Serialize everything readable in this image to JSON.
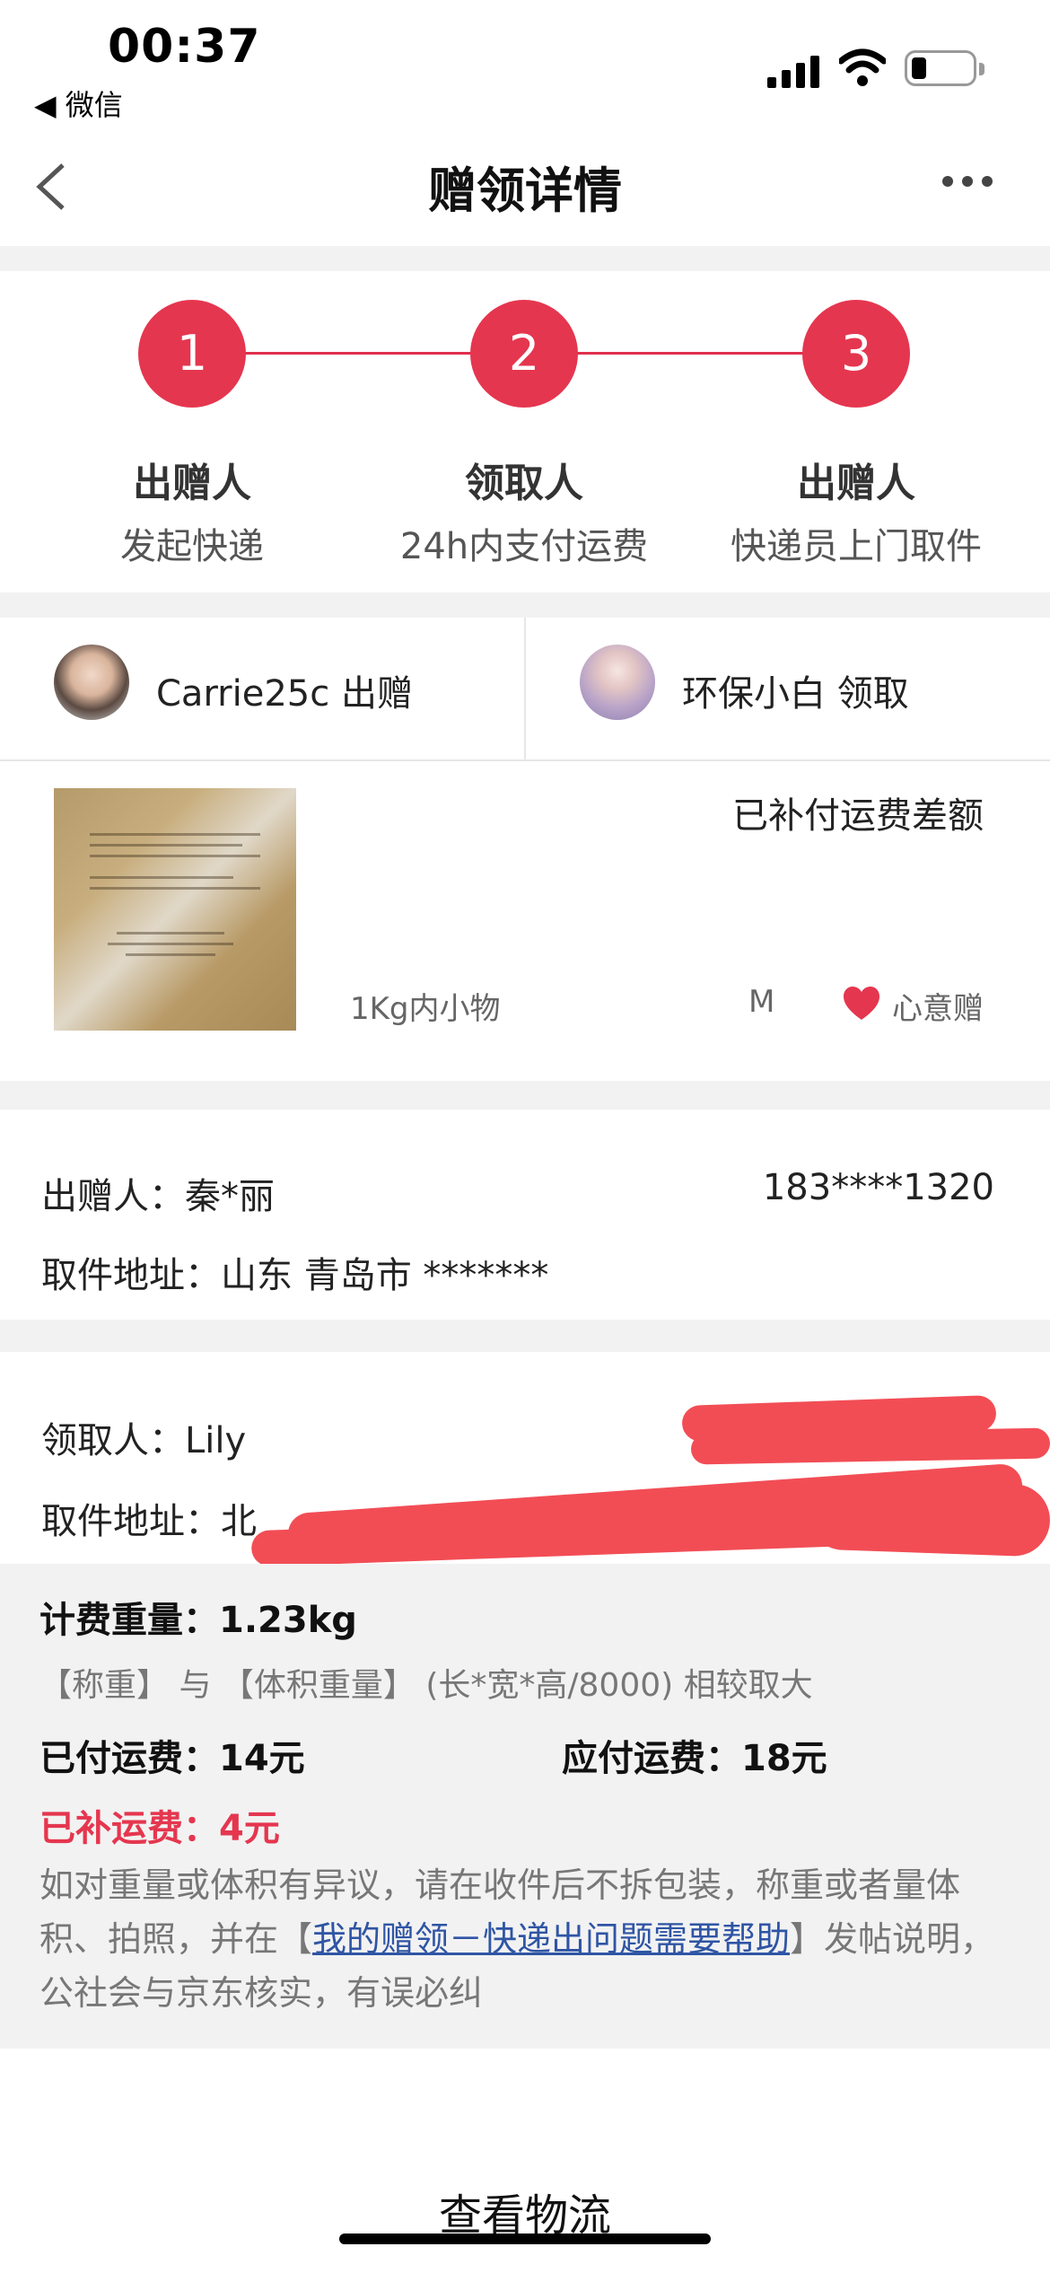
{
  "status_bar": {
    "time": "00:37",
    "back_app": "◀ 微信"
  },
  "nav": {
    "title": "赠领详情",
    "back_icon": "chevron-left-icon",
    "more_icon": "more-dots-icon"
  },
  "steps": [
    {
      "number": "1",
      "title": "出赠人",
      "subtitle": "发起快递"
    },
    {
      "number": "2",
      "title": "领取人",
      "subtitle": "24h内支付运费"
    },
    {
      "number": "3",
      "title": "出赠人",
      "subtitle": "快递员上门取件"
    }
  ],
  "users": {
    "giver": "Carrie25c 出赠",
    "receiver": "环保小白 领取"
  },
  "item": {
    "status": "已补付运费差额",
    "category": "1Kg内小物",
    "size": "M",
    "tag": "心意赠"
  },
  "giver_info": {
    "name": "出赠人：秦*丽",
    "phone": "183****1320",
    "address": "取件地址：山东 青岛市 *******"
  },
  "receiver_info": {
    "name": "领取人：Lily",
    "address": "取件地址：北"
  },
  "shipping": {
    "weight": "计费重量：1.23kg",
    "rule": "【称重】 与 【体积重量】 (长*宽*高/8000) 相较取大",
    "paid": "已付运费：14元",
    "due": "应付运费：18元",
    "supplement": "已补运费：4元",
    "note_before": "如对重量或体积有异议，请在收件后不拆包装，称重或者量体积、拍照，并在【",
    "note_link": "我的赠领－快递出问题需要帮助",
    "note_after": "】发帖说明，公社会与京东核实，有误必纠"
  },
  "bottom": {
    "button": "查看物流"
  },
  "colors": {
    "accent": "#e5364f",
    "link": "#2f55a4",
    "background_gray": "#f2f2f2"
  }
}
